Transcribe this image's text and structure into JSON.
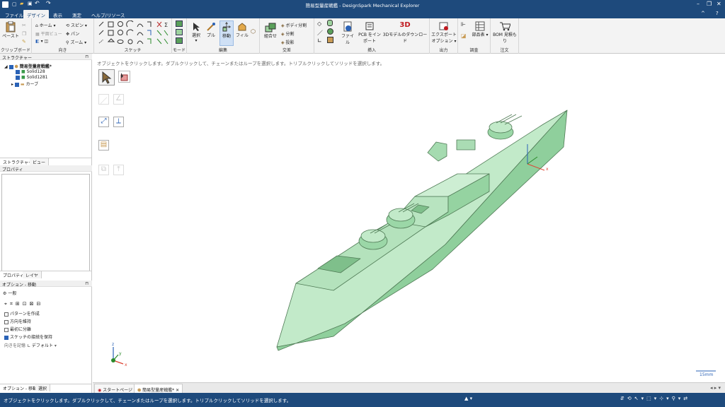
{
  "window": {
    "title": "簡易型量産戦艦 - DesignSpark Mechanical Explorer",
    "controls": [
      "minimize",
      "restore",
      "close"
    ]
  },
  "menu": {
    "tabs": [
      "ファイル",
      "デザイン",
      "表示",
      "測定",
      "ヘルプ/リソース"
    ],
    "active": "デザイン"
  },
  "ribbon": {
    "clipboard": {
      "paste": "ペースト",
      "group": "クリップボード"
    },
    "orient": {
      "home": "ホーム",
      "plane_view": "平面ビュー",
      "spin": "スピン",
      "pan": "パン",
      "zoom": "ズーム",
      "group": "向き"
    },
    "sketch": {
      "group": "スケッチ"
    },
    "mode": {
      "group": "モード"
    },
    "edit": {
      "select": "選択",
      "pull": "プル",
      "move": "移動",
      "fill": "フィル",
      "group": "編集"
    },
    "intersect": {
      "combine": "組合せ",
      "split_body": "ボディ分割",
      "split": "分割",
      "project": "投影",
      "group": "交差"
    },
    "insert": {
      "file": "ファイル",
      "pcb": "PCB をインポート",
      "download": "3Dモデルのダウンロード",
      "group": "挿入"
    },
    "output": {
      "export": "エクスポートオプション",
      "group": "出力"
    },
    "investigate": {
      "bom_parts": "部品表",
      "group": "調査"
    },
    "order": {
      "bom_quote": "BOM 見積もり",
      "group": "注文"
    }
  },
  "structure": {
    "header": "ストラクチャー",
    "root": "簡易型量産戦艦*",
    "items": [
      "Solid128",
      "Solid1281",
      "カーブ"
    ]
  },
  "structure_tabs": [
    "ストラクチャー",
    "ビュー"
  ],
  "properties": {
    "header": "プロパティ"
  },
  "property_tabs": [
    "プロパティ",
    "レイヤ"
  ],
  "options": {
    "header": "オプション - 移動",
    "general": "一般",
    "checks": [
      {
        "label": "パターンを作成",
        "checked": false
      },
      {
        "label": "方向を維持",
        "checked": false
      },
      {
        "label": "最初に分離",
        "checked": false
      },
      {
        "label": "スケッチの接続を保持",
        "checked": true
      }
    ],
    "orient_label": "向きを記憶",
    "orient_value": "デフォルト"
  },
  "option_tabs": [
    "オプション - 移動",
    "選択"
  ],
  "viewport": {
    "hint": "オブジェクトをクリックします。ダブルクリックして、チェーンまたはループを選択します。トリプルクリックしてソリッドを選択します。",
    "scale": "15mm",
    "axes": {
      "x": "x",
      "y": "y",
      "z": "z"
    }
  },
  "doc_tabs": [
    "スタートページ",
    "簡易型量産戦艦*"
  ],
  "status": {
    "message": "オブジェクトをクリックします。ダブルクリックして、チェーンまたはループを選択します。トリプルクリックしてソリッドを選択します。"
  },
  "colors": {
    "accent": "#1e4a7c",
    "model": "#a9ddb2",
    "model_edge": "#4f7a55"
  }
}
